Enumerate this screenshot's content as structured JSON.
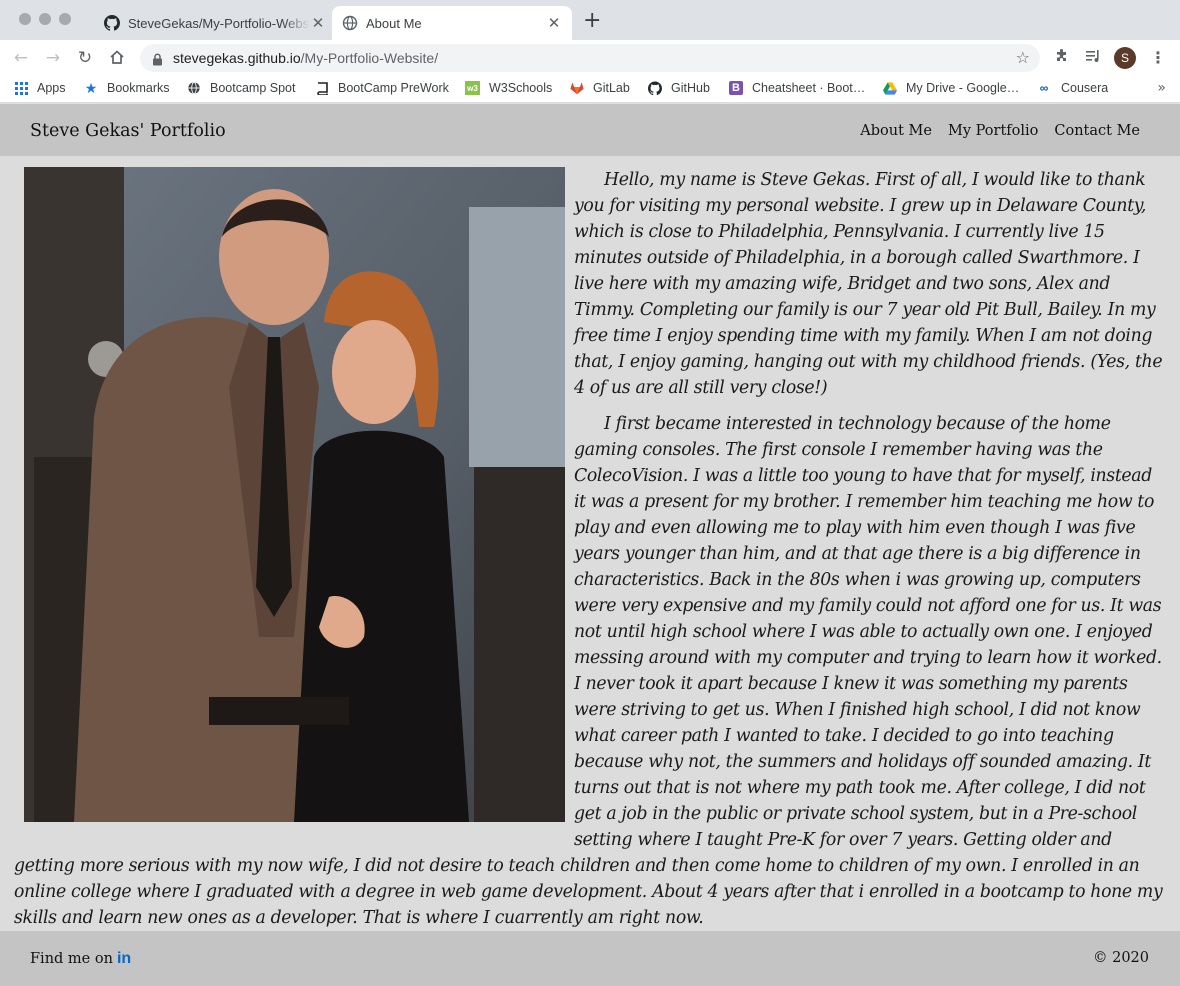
{
  "browser": {
    "tabs": [
      {
        "title": "SteveGekas/My-Portfolio-Website",
        "icon": "github-icon",
        "active": false
      },
      {
        "title": "About Me",
        "icon": "globe-icon",
        "active": true
      }
    ],
    "url_host": "stevegekas.github.io",
    "url_path": "/My-Portfolio-Website/",
    "profile_initial": "S",
    "bookmarks": [
      {
        "label": "Apps",
        "icon": "apps-grid-icon"
      },
      {
        "label": "Bookmarks",
        "icon": "star-icon"
      },
      {
        "label": "Bootcamp Spot",
        "icon": "globe-icon"
      },
      {
        "label": "BootCamp PreWork",
        "icon": "book-icon"
      },
      {
        "label": "W3Schools",
        "icon": "w3schools-icon"
      },
      {
        "label": "GitLab",
        "icon": "gitlab-icon"
      },
      {
        "label": "GitHub",
        "icon": "github-icon"
      },
      {
        "label": "Cheatsheet · Boot…",
        "icon": "bootstrap-icon"
      },
      {
        "label": "My Drive - Google…",
        "icon": "google-drive-icon"
      },
      {
        "label": "Cousera",
        "icon": "coursera-icon"
      }
    ]
  },
  "site": {
    "brand": "Steve Gekas' Portfolio",
    "nav": [
      "About Me",
      "My Portfolio",
      "Contact Me"
    ],
    "paragraphs": [
      "Hello, my name is Steve Gekas. First of all, I would like to thank you for visiting my personal website. I grew up in Delaware County, which is close to Philadelphia, Pennsylvania. I currently live 15 minutes outside of Philadelphia, in a borough called Swarthmore. I live here with my amazing wife, Bridget and two sons, Alex and Timmy. Completing our family is our 7 year old Pit Bull, Bailey. In my free time I enjoy spending time with my family. When I am not doing that, I enjoy gaming, hanging out with my childhood friends. (Yes, the 4 of us are all still very close!)",
      "I first became interested in technology because of the home gaming consoles. The first console I remember having was the ColecoVision. I was a little too young to have that for myself, instead it was a present for my brother. I remember him teaching me how to play and even allowing me to play with him even though I was five years younger than him, and at that age there is a big difference in characteristics. Back in the 80s when i was growing up, computers were very expensive and my family could not afford one for us. It was not until high school where I was able to actually own one. I enjoyed messing around with my computer and trying to learn how it worked. I never took it apart because I knew it was something my parents were striving to get us. When I finished high school, I did not know what career path I wanted to take. I decided to go into teaching because why not, the summers and holidays off sounded amazing. It turns out that is not where my path took me. After college, I did not get a job in the public or private school system, but in a Pre-school setting where I taught Pre-K for over 7 years. Getting older and getting more serious with my now wife, I did not desire to teach children and then come home to children of my own. I enrolled in an online college where I graduated with a degree in web game development. About 4 years after that i enrolled in a bootcamp to hone my skills and learn new ones as a developer. That is where I cuarrently am right now."
    ],
    "footer_find": "Find me on",
    "footer_social": "in",
    "copyright": "© 2020"
  }
}
